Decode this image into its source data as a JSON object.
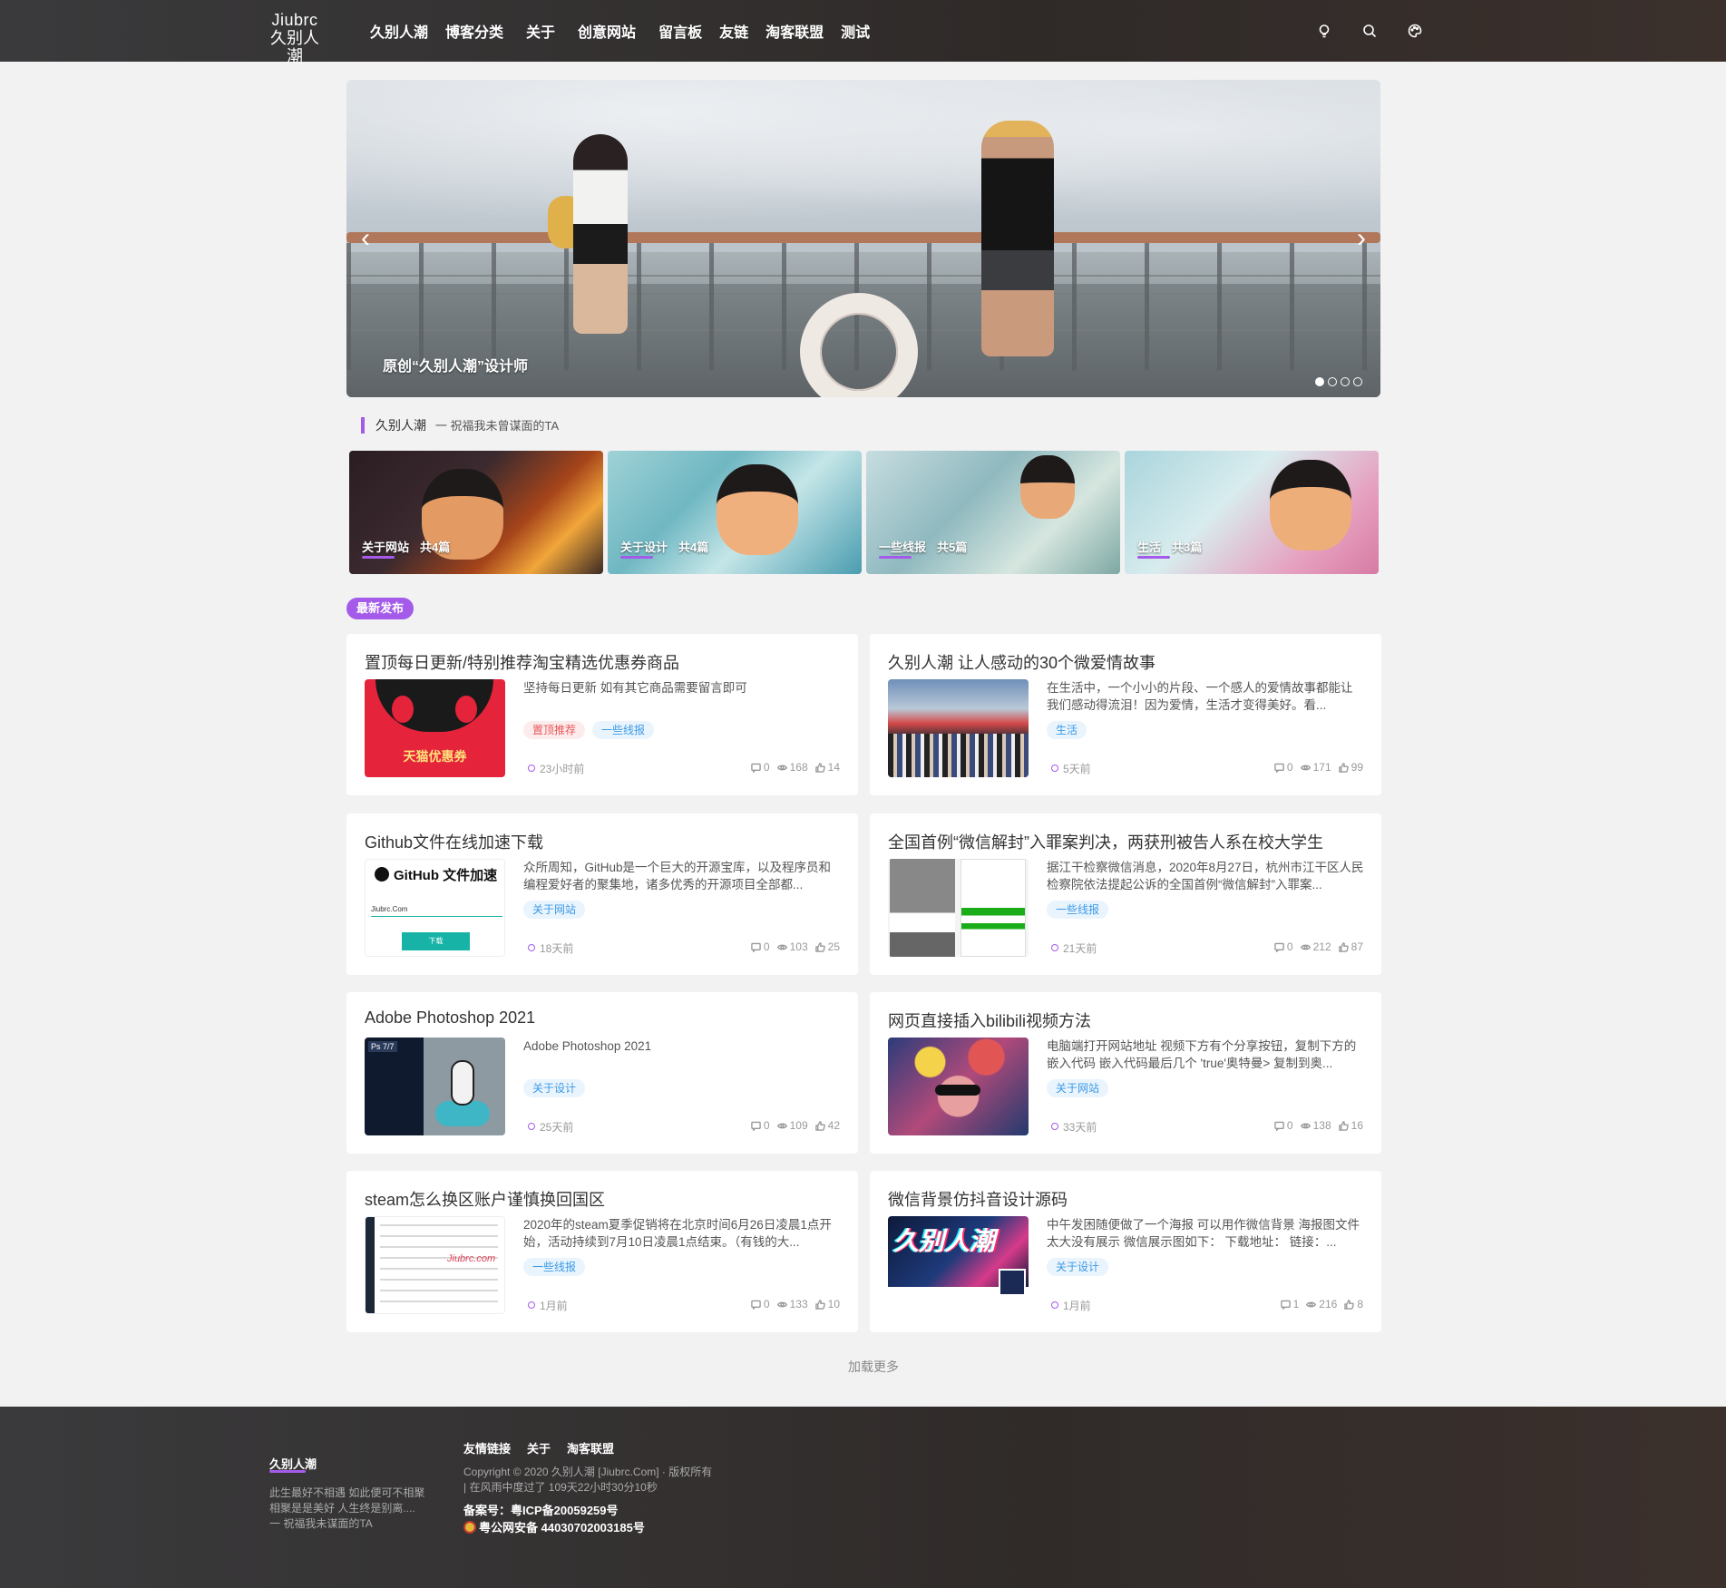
{
  "header": {
    "logo_en": "Jiubrc",
    "logo_cn": "久别人潮",
    "nav": [
      "久别人潮",
      "博客分类",
      "关于",
      "创意网站",
      "留言板",
      "友链",
      "淘客联盟",
      "测试"
    ]
  },
  "banner": {
    "caption": "原创“久别人潮”设计师",
    "slides_total": 4,
    "active_slide": 1
  },
  "motto": {
    "name": "久别人潮",
    "text": "一 祝福我未曾谋面的TA"
  },
  "categories": [
    {
      "name": "关于网站",
      "count": "共4篇"
    },
    {
      "name": "关于设计",
      "count": "共4篇"
    },
    {
      "name": "一些线报",
      "count": "共5篇"
    },
    {
      "name": "生活",
      "count": "共3篇"
    }
  ],
  "latest_label": "最新发布",
  "posts": [
    {
      "title": "置顶每日更新/特别推荐淘宝精选优惠券商品",
      "excerpt": "坚持每日更新 如有其它商品需要留言即可",
      "tags": [
        {
          "label": "置顶推荐",
          "color": "red"
        },
        {
          "label": "一些线报",
          "color": "blue"
        }
      ],
      "time": "23小时前",
      "comments": "0",
      "views": "168",
      "likes": "14",
      "thumb": "tmall"
    },
    {
      "title": "久别人潮 让人感动的30个微爱情故事",
      "excerpt": "在生活中，一个小小的片段、一个感人的爱情故事都能让我们感动得流泪！因为爱情，生活才变得美好。看...",
      "tags": [
        {
          "label": "生活",
          "color": "blue"
        }
      ],
      "time": "5天前",
      "comments": "0",
      "views": "171",
      "likes": "99",
      "thumb": "street"
    },
    {
      "title": "Github文件在线加速下载",
      "excerpt": "众所周知，GitHub是一个巨大的开源宝库，以及程序员和编程爱好者的聚集地，诸多优秀的开源项目全部都...",
      "tags": [
        {
          "label": "关于网站",
          "color": "blue"
        }
      ],
      "time": "18天前",
      "comments": "0",
      "views": "103",
      "likes": "25",
      "thumb": "github"
    },
    {
      "title": "全国首例“微信解封”入罪案判决，两获刑被告人系在校大学生",
      "excerpt": "据江干检察微信消息，2020年8月27日，杭州市江干区人民检察院依法提起公诉的全国首例“微信解封”入罪案...",
      "tags": [
        {
          "label": "一些线报",
          "color": "blue"
        }
      ],
      "time": "21天前",
      "comments": "0",
      "views": "212",
      "likes": "87",
      "thumb": "phones"
    },
    {
      "title": "Adobe Photoshop 2021",
      "excerpt": "Adobe Photoshop 2021",
      "tags": [
        {
          "label": "关于设计",
          "color": "blue"
        }
      ],
      "time": "25天前",
      "comments": "0",
      "views": "109",
      "likes": "42",
      "thumb": "photoshop"
    },
    {
      "title": "网页直接插入bilibili视频方法",
      "excerpt": "电脑端打开网站地址 视频下方有个分享按钮，复制下方的嵌入代码 嵌入代码最后几个 'true'奥特曼> 复制到奥...",
      "tags": [
        {
          "label": "关于网站",
          "color": "blue"
        }
      ],
      "time": "33天前",
      "comments": "0",
      "views": "138",
      "likes": "16",
      "thumb": "colorful"
    },
    {
      "title": "steam怎么换区账户谨慎换回国区",
      "excerpt": "2020年的steam夏季促销将在北京时间6月26日凌晨1点开始，活动持续到7月10日凌晨1点结束。（有钱的大...",
      "tags": [
        {
          "label": "一些线报",
          "color": "blue"
        }
      ],
      "time": "1月前",
      "comments": "0",
      "views": "133",
      "likes": "10",
      "thumb": "steam"
    },
    {
      "title": "微信背景仿抖音设计源码",
      "excerpt": "中午发困随便做了一个海报 可以用作微信背景 海报图文件太大没有展示 微信展示图如下： 下载地址： 链接：...",
      "tags": [
        {
          "label": "关于设计",
          "color": "blue"
        }
      ],
      "time": "1月前",
      "comments": "1",
      "views": "216",
      "likes": "8",
      "thumb": "poster"
    }
  ],
  "thumb_text": {
    "tmall_banner": "天猫优惠券",
    "github_title": "GitHub 文件加速",
    "github_input": "Jiubrc.Com",
    "github_button": "下载",
    "poster_title": "久别人潮",
    "steam_watermark": "Jiubrc.com",
    "ps_label": "Ps 7/7"
  },
  "load_more": "加载更多",
  "footer": {
    "brand": "久别人潮",
    "about": [
      "此生最好不相遇 如此便可不相聚",
      "相聚是是美好 人生终是别离....",
      "一 祝福我未谋面的TA"
    ],
    "links": [
      "友情链接",
      "关于",
      "淘客联盟"
    ],
    "copyright": "Copyright © 2020 久别人潮 [Jiubrc.Com] · 版权所有",
    "uptime": "| 在风雨中度过了 109天22小时30分10秒",
    "icp": "备案号：粤ICP备20059259号",
    "police": "粤公网安备 44030702003185号"
  },
  "colors": {
    "accent": "#a45bea",
    "header_bg": "#332d2b",
    "tag_blue": "#3b9ae6",
    "tag_red": "#e8565a"
  }
}
